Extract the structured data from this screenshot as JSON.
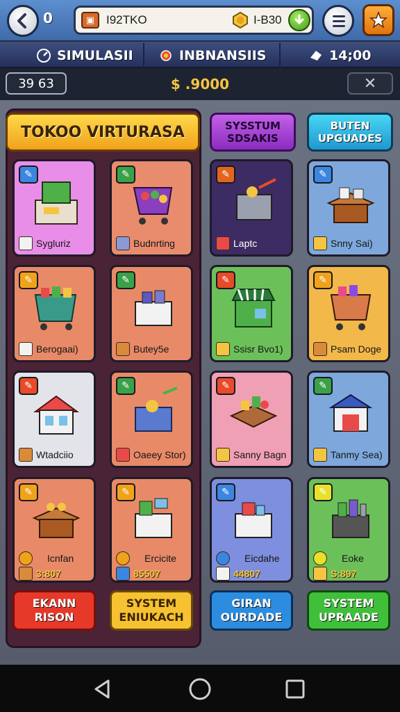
{
  "topbar": {
    "back_count": "0",
    "resource_a": "I92TKO",
    "resource_b": "I-B30"
  },
  "nav": {
    "simulation_label": "SIMULASII",
    "finance_label": "INBNANSIIS",
    "time_label": "14;00"
  },
  "stats": {
    "level": "39 63",
    "money": "$ .9000",
    "close_label": "✕"
  },
  "panel": {
    "title": "TOKOO VIRTURASA",
    "system_btn": "SYSSTUM SDSAKIS",
    "upgrade_btn": "BUTEN UPGUADES"
  },
  "cards": [
    {
      "label": "Sygluriz",
      "bg": "#e98ee8",
      "badge": "#3b86e0",
      "foot": "#f2f2f2"
    },
    {
      "label": "Budnrting",
      "bg": "#e98c6e",
      "badge": "#3aa04a",
      "foot": "#8b9ad6"
    },
    {
      "label": "Laptc",
      "bg": "#3d2c63",
      "badge": "#e2651f",
      "foot": "#e84a4a",
      "light": true
    },
    {
      "label": "Snny Sai)",
      "bg": "#7ea8dc",
      "badge": "#3b86e0",
      "foot": "#f4c542"
    },
    {
      "label": "Berogaai)",
      "bg": "#e88a68",
      "badge": "#f0a21a",
      "foot": "#f2f2f2"
    },
    {
      "label": "Butey5e",
      "bg": "#e88a68",
      "badge": "#3aa04a",
      "foot": "#d98a3a"
    },
    {
      "label": "Ssisr Bvo1)",
      "bg": "#6cc05a",
      "badge": "#e84a2a",
      "foot": "#f4c542"
    },
    {
      "label": "Psam Doge",
      "bg": "#f2b84a",
      "badge": "#f0a21a",
      "foot": "#d98a3a"
    },
    {
      "label": "Wtadciio",
      "bg": "#e3e4ea",
      "badge": "#e84a2a",
      "foot": "#d98a3a"
    },
    {
      "label": "Oaeey Stor)",
      "bg": "#e88a68",
      "badge": "#3aa04a",
      "foot": "#e84a4a"
    },
    {
      "label": "Sanny Bagn",
      "bg": "#f0a0b4",
      "badge": "#e84a2a",
      "foot": "#f4c542"
    },
    {
      "label": "Tanmy Sea)",
      "bg": "#7ea8dc",
      "badge": "#3aa04a",
      "foot": "#f4c542"
    },
    {
      "label": "Icnfan",
      "price": "3:807",
      "bg": "#e88a68",
      "badge": "#f0a21a",
      "foot": "#d98a3a"
    },
    {
      "label": "Ercicite",
      "price": "85507",
      "bg": "#e88a68",
      "badge": "#f0a21a",
      "foot": "#3b86e0"
    },
    {
      "label": "Eicdahe",
      "price": "44807",
      "bg": "#7e8fe0",
      "badge": "#3b86e0",
      "foot": "#f2f2f2"
    },
    {
      "label": "Eoke",
      "price": "S:897",
      "bg": "#6cc05a",
      "badge": "#e8e02a",
      "foot": "#f4c542"
    }
  ],
  "actions": [
    {
      "label": "EKANN RISON",
      "bg": "#e6392a",
      "dark": "#7a0f08"
    },
    {
      "label": "SYSTEM ENIUKACH",
      "bg": "#f6c232",
      "dark": "#6a4a05"
    },
    {
      "label": "GIRAN OURDADE",
      "bg": "#2c8de0",
      "dark": "#0a2f5a"
    },
    {
      "label": "SYSTEM UPRAADE",
      "bg": "#3fbf3a",
      "dark": "#0f4a0c"
    }
  ]
}
